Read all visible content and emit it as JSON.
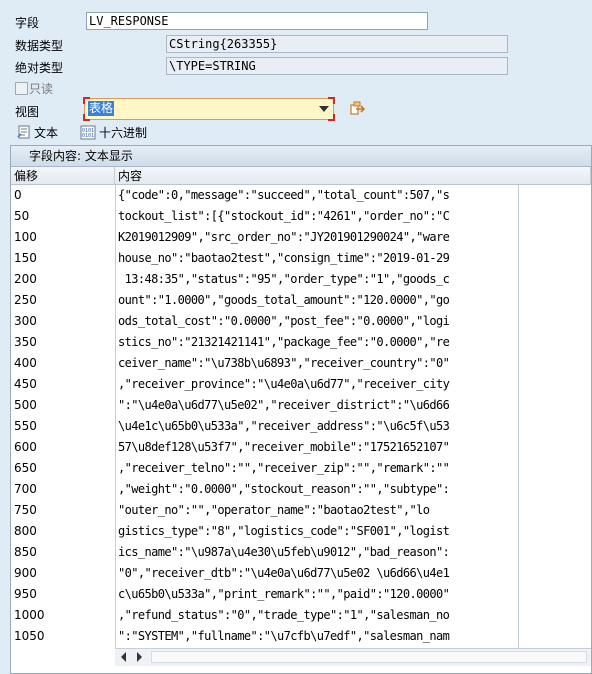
{
  "form": {
    "field_label": "字段",
    "field_value": "LV_RESPONSE",
    "datatype_label": "数据类型",
    "datatype_value": "CString{263355}",
    "abstype_label": "绝对类型",
    "abstype_value": "\\TYPE=STRING",
    "readonly_label": "只读",
    "view_label": "视图",
    "view_value": "表格"
  },
  "toolbar": {
    "text_label": "文本",
    "hex_label": "十六进制",
    "hex_icon_text": "0101"
  },
  "panel": {
    "title": "字段内容: 文本显示",
    "col_offset": "偏移",
    "col_content": "内容",
    "rows": [
      {
        "offset": "0",
        "text": "{\"code\":0,\"message\":\"succeed\",\"total_count\":507,\"s"
      },
      {
        "offset": "50",
        "text": "tockout_list\":[{\"stockout_id\":\"4261\",\"order_no\":\"C"
      },
      {
        "offset": "100",
        "text": "K2019012909\",\"src_order_no\":\"JY201901290024\",\"ware"
      },
      {
        "offset": "150",
        "text": "house_no\":\"baotao2test\",\"consign_time\":\"2019-01-29"
      },
      {
        "offset": "200",
        "text": " 13:48:35\",\"status\":\"95\",\"order_type\":\"1\",\"goods_c"
      },
      {
        "offset": "250",
        "text": "ount\":\"1.0000\",\"goods_total_amount\":\"120.0000\",\"go"
      },
      {
        "offset": "300",
        "text": "ods_total_cost\":\"0.0000\",\"post_fee\":\"0.0000\",\"logi"
      },
      {
        "offset": "350",
        "text": "stics_no\":\"21321421141\",\"package_fee\":\"0.0000\",\"re"
      },
      {
        "offset": "400",
        "text": "ceiver_name\":\"\\u738b\\u6893\",\"receiver_country\":\"0\""
      },
      {
        "offset": "450",
        "text": ",\"receiver_province\":\"\\u4e0a\\u6d77\",\"receiver_city"
      },
      {
        "offset": "500",
        "text": "\":\"\\u4e0a\\u6d77\\u5e02\",\"receiver_district\":\"\\u6d66"
      },
      {
        "offset": "550",
        "text": "\\u4e1c\\u65b0\\u533a\",\"receiver_address\":\"\\u6c5f\\u53"
      },
      {
        "offset": "600",
        "text": "57\\u8def128\\u53f7\",\"receiver_mobile\":\"17521652107\""
      },
      {
        "offset": "650",
        "text": ",\"receiver_telno\":\"\",\"receiver_zip\":\"\",\"remark\":\"\""
      },
      {
        "offset": "700",
        "text": ",\"weight\":\"0.0000\",\"stockout_reason\":\"\",\"subtype\":"
      },
      {
        "offset": "750",
        "text": "\"outer_no\":\"\",\"operator_name\":\"baotao2test\",\"lo"
      },
      {
        "offset": "800",
        "text": "gistics_type\":\"8\",\"logistics_code\":\"SF001\",\"logist"
      },
      {
        "offset": "850",
        "text": "ics_name\":\"\\u987a\\u4e30\\u5feb\\u9012\",\"bad_reason\":"
      },
      {
        "offset": "900",
        "text": "\"0\",\"receiver_dtb\":\"\\u4e0a\\u6d77\\u5e02 \\u6d66\\u4e1"
      },
      {
        "offset": "950",
        "text": "c\\u65b0\\u533a\",\"print_remark\":\"\",\"paid\":\"120.0000\""
      },
      {
        "offset": "1000",
        "text": ",\"refund_status\":\"0\",\"trade_type\":\"1\",\"salesman_no"
      },
      {
        "offset": "1050",
        "text": "\":\"SYSTEM\",\"fullname\":\"\\u7cfb\\u7edf\",\"salesman_nam"
      }
    ]
  },
  "colors": {
    "background": "#dfebf5",
    "select_bg": "#fff7c6",
    "selection": "#3d7fd2",
    "focus_corner": "#cc2a2a"
  },
  "icons": {
    "execute": "execute-arrow-icon",
    "text": "text-view-icon",
    "hex": "hex-view-icon",
    "dropdown": "chevron-down-icon"
  }
}
